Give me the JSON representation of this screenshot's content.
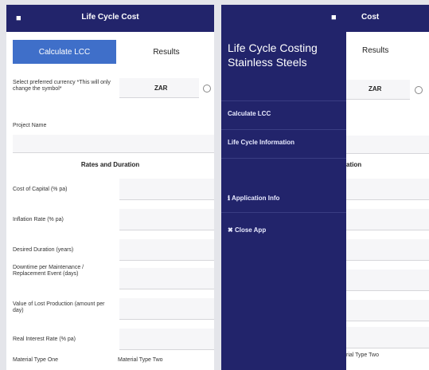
{
  "left": {
    "appbar": {
      "title": "Life Cycle Cost"
    },
    "tabs": {
      "calculate": "Calculate LCC",
      "results": "Results"
    },
    "currency": {
      "label": "Select preferred currency *This will only change the symbol*",
      "value": "ZAR"
    },
    "project_name_label": "Project Name",
    "section_rates": "Rates and Duration",
    "fields": [
      "Cost of Capital (% pa)",
      "Inflation Rate (% pa)",
      "Desired Duration (years)",
      "Downtime per Maintenance / Replacement Event (days)",
      "Value of Lost Production (amount per day)",
      "Real Interest Rate (% pa)"
    ],
    "material_one": "Material Type One",
    "material_two": "Material Type Two"
  },
  "right": {
    "appbar": {
      "title": "Cost"
    },
    "tabs": {
      "results": "Results"
    },
    "currency": {
      "value": "ZAR"
    },
    "section_fragment": "ation",
    "material_two_fragment": "rial Type Two",
    "drawer": {
      "title": "Life Cycle Costing Stainless Steels",
      "items": [
        "Calculate LCC",
        "Life Cycle Information"
      ],
      "app_info": "Application Info",
      "close_app": "Close App"
    }
  },
  "colors": {
    "navy": "#22246b",
    "accent": "#3f6fc9",
    "bg": "#e4e5ea"
  }
}
